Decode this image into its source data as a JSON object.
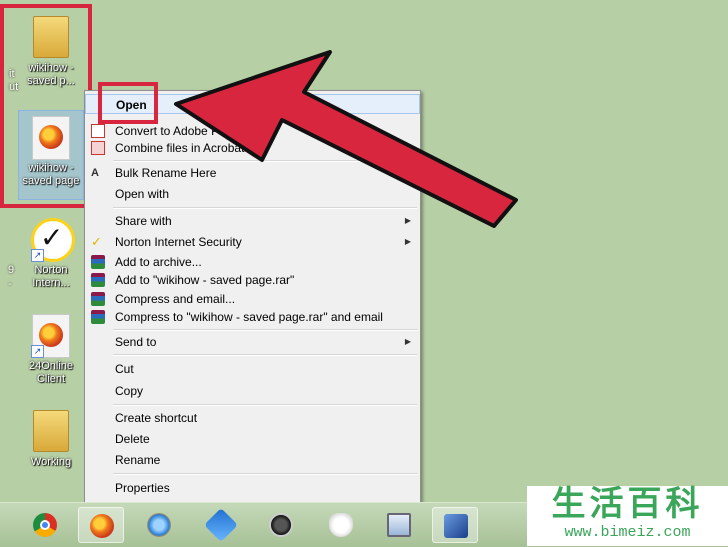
{
  "desktop_icons": [
    {
      "label": "wikihow -\nsaved p..."
    },
    {
      "label": "wikihow -\nsaved page"
    },
    {
      "label": "Norton\nIntern..."
    },
    {
      "label": "24Online\nClient"
    },
    {
      "label": "Working"
    }
  ],
  "edge_text": [
    "it",
    "ut",
    "9",
    "-"
  ],
  "context_menu": {
    "items": [
      {
        "label": "Open",
        "highlighted": true
      },
      {
        "label": "Convert to Adobe PDF",
        "icon": "pdf-icon"
      },
      {
        "label": "Combine files in Acrobat...",
        "icon": "acrobat-combine-icon"
      },
      {
        "label": "Bulk Rename Here",
        "icon": "bulk-rename-icon"
      },
      {
        "label": "Open with"
      },
      {
        "label": "Share with",
        "submenu": true
      },
      {
        "label": "Norton Internet Security",
        "icon": "norton-check-icon",
        "submenu": true
      },
      {
        "label": "Add to archive...",
        "icon": "winrar-icon"
      },
      {
        "label": "Add to \"wikihow - saved page.rar\"",
        "icon": "winrar-icon"
      },
      {
        "label": "Compress and email...",
        "icon": "winrar-icon"
      },
      {
        "label": "Compress to \"wikihow - saved page.rar\" and email",
        "icon": "winrar-icon"
      },
      {
        "label": "Send to",
        "submenu": true
      },
      {
        "label": "Cut"
      },
      {
        "label": "Copy"
      },
      {
        "label": "Create shortcut"
      },
      {
        "label": "Delete"
      },
      {
        "label": "Rename"
      },
      {
        "label": "Properties"
      }
    ]
  },
  "taskbar": {
    "apps": [
      "chrome-icon",
      "firefox-icon",
      "sync-icon",
      "puzzle-icon",
      "speedometer-icon",
      "wolf-icon",
      "monitor-icon",
      "virtualbox-icon"
    ]
  },
  "watermark": {
    "chinese": "生活百科",
    "url": "www.bimeiz.com"
  },
  "colors": {
    "desktop": "#b7cfa5",
    "annotation_red": "#d7263d",
    "menu_bg": "#f0f0f0",
    "watermark_green": "#3aa65a"
  }
}
